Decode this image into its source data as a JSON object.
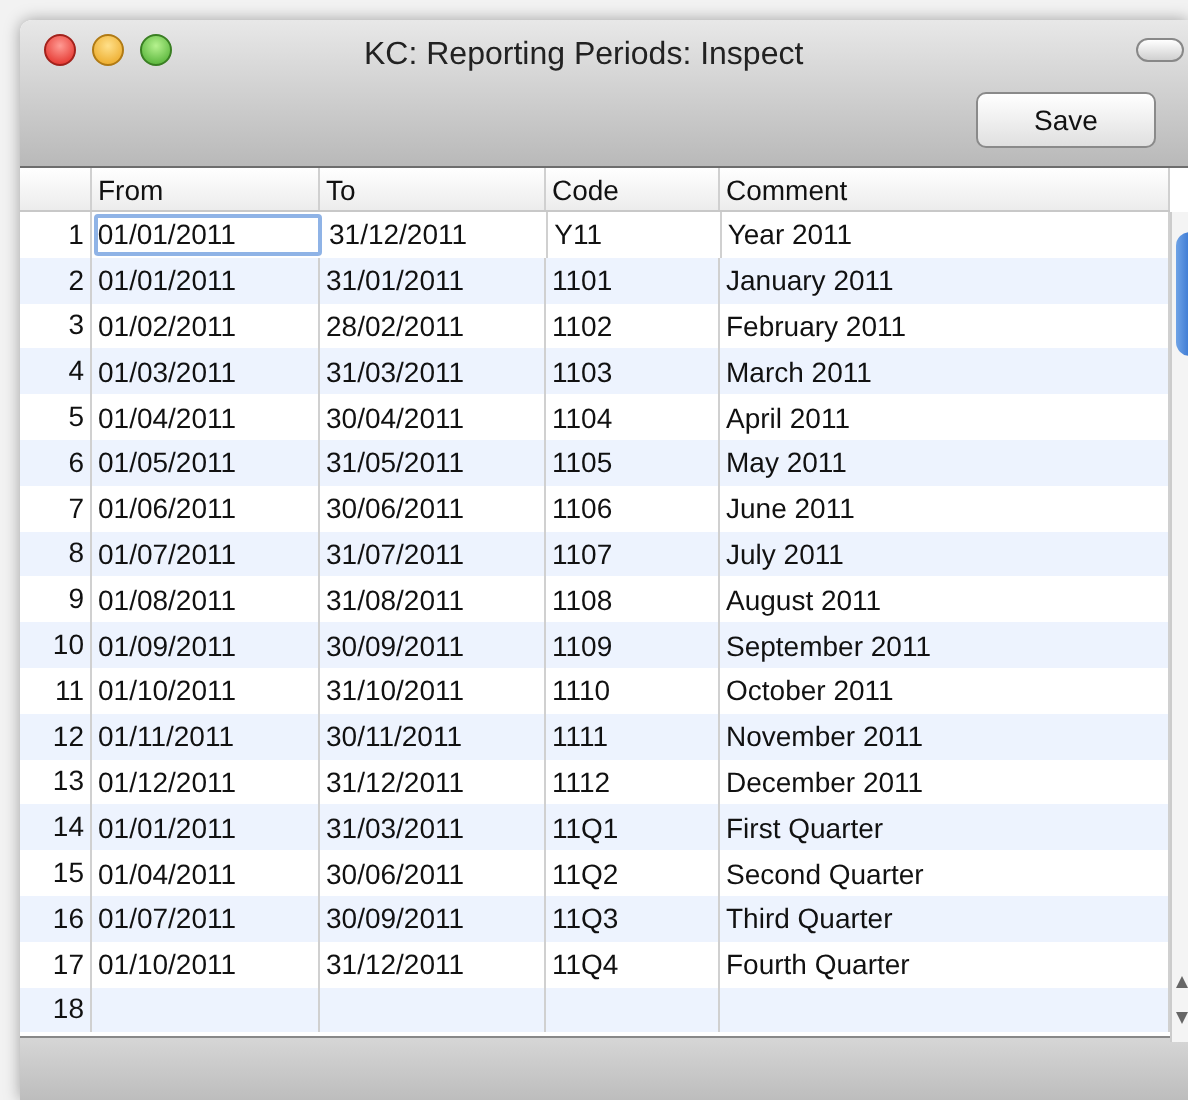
{
  "window": {
    "title": "KC: Reporting Periods: Inspect"
  },
  "toolbar": {
    "buttons": [
      "Save"
    ]
  },
  "table": {
    "columns": [
      "From",
      "To",
      "Code",
      "Comment"
    ],
    "rows": [
      {
        "number": "1",
        "cells": [
          "01/01/2011",
          "31/12/2011",
          "Y11",
          "Year 2011"
        ],
        "focused": true
      },
      {
        "number": "2",
        "cells": [
          "01/01/2011",
          "31/01/2011",
          "1101",
          "January 2011"
        ],
        "focused": false
      },
      {
        "number": "3",
        "cells": [
          "01/02/2011",
          "28/02/2011",
          "1102",
          "February 2011"
        ],
        "focused": false
      },
      {
        "number": "4",
        "cells": [
          "01/03/2011",
          "31/03/2011",
          "1103",
          "March 2011"
        ],
        "focused": false
      },
      {
        "number": "5",
        "cells": [
          "01/04/2011",
          "30/04/2011",
          "1104",
          "April 2011"
        ],
        "focused": false
      },
      {
        "number": "6",
        "cells": [
          "01/05/2011",
          "31/05/2011",
          "1105",
          "May 2011"
        ],
        "focused": false
      },
      {
        "number": "7",
        "cells": [
          "01/06/2011",
          "30/06/2011",
          "1106",
          "June 2011"
        ],
        "focused": false
      },
      {
        "number": "8",
        "cells": [
          "01/07/2011",
          "31/07/2011",
          "1107",
          "July 2011"
        ],
        "focused": false
      },
      {
        "number": "9",
        "cells": [
          "01/08/2011",
          "31/08/2011",
          "1108",
          "August 2011"
        ],
        "focused": false
      },
      {
        "number": "10",
        "cells": [
          "01/09/2011",
          "30/09/2011",
          "1109",
          "September 2011"
        ],
        "focused": false
      },
      {
        "number": "11",
        "cells": [
          "01/10/2011",
          "31/10/2011",
          "1110",
          "October 2011"
        ],
        "focused": false
      },
      {
        "number": "12",
        "cells": [
          "01/11/2011",
          "30/11/2011",
          "1111",
          "November 2011"
        ],
        "focused": false
      },
      {
        "number": "13",
        "cells": [
          "01/12/2011",
          "31/12/2011",
          "1112",
          "December 2011"
        ],
        "focused": false
      },
      {
        "number": "14",
        "cells": [
          "01/01/2011",
          "31/03/2011",
          "11Q1",
          "First Quarter"
        ],
        "focused": false
      },
      {
        "number": "15",
        "cells": [
          "01/04/2011",
          "30/06/2011",
          "11Q2",
          "Second Quarter"
        ],
        "focused": false
      },
      {
        "number": "16",
        "cells": [
          "01/07/2011",
          "30/09/2011",
          "11Q3",
          "Third Quarter"
        ],
        "focused": false
      },
      {
        "number": "17",
        "cells": [
          "01/10/2011",
          "31/12/2011",
          "11Q4",
          "Fourth Quarter"
        ],
        "focused": false
      },
      {
        "number": "18",
        "cells": [],
        "focused": false
      }
    ]
  }
}
